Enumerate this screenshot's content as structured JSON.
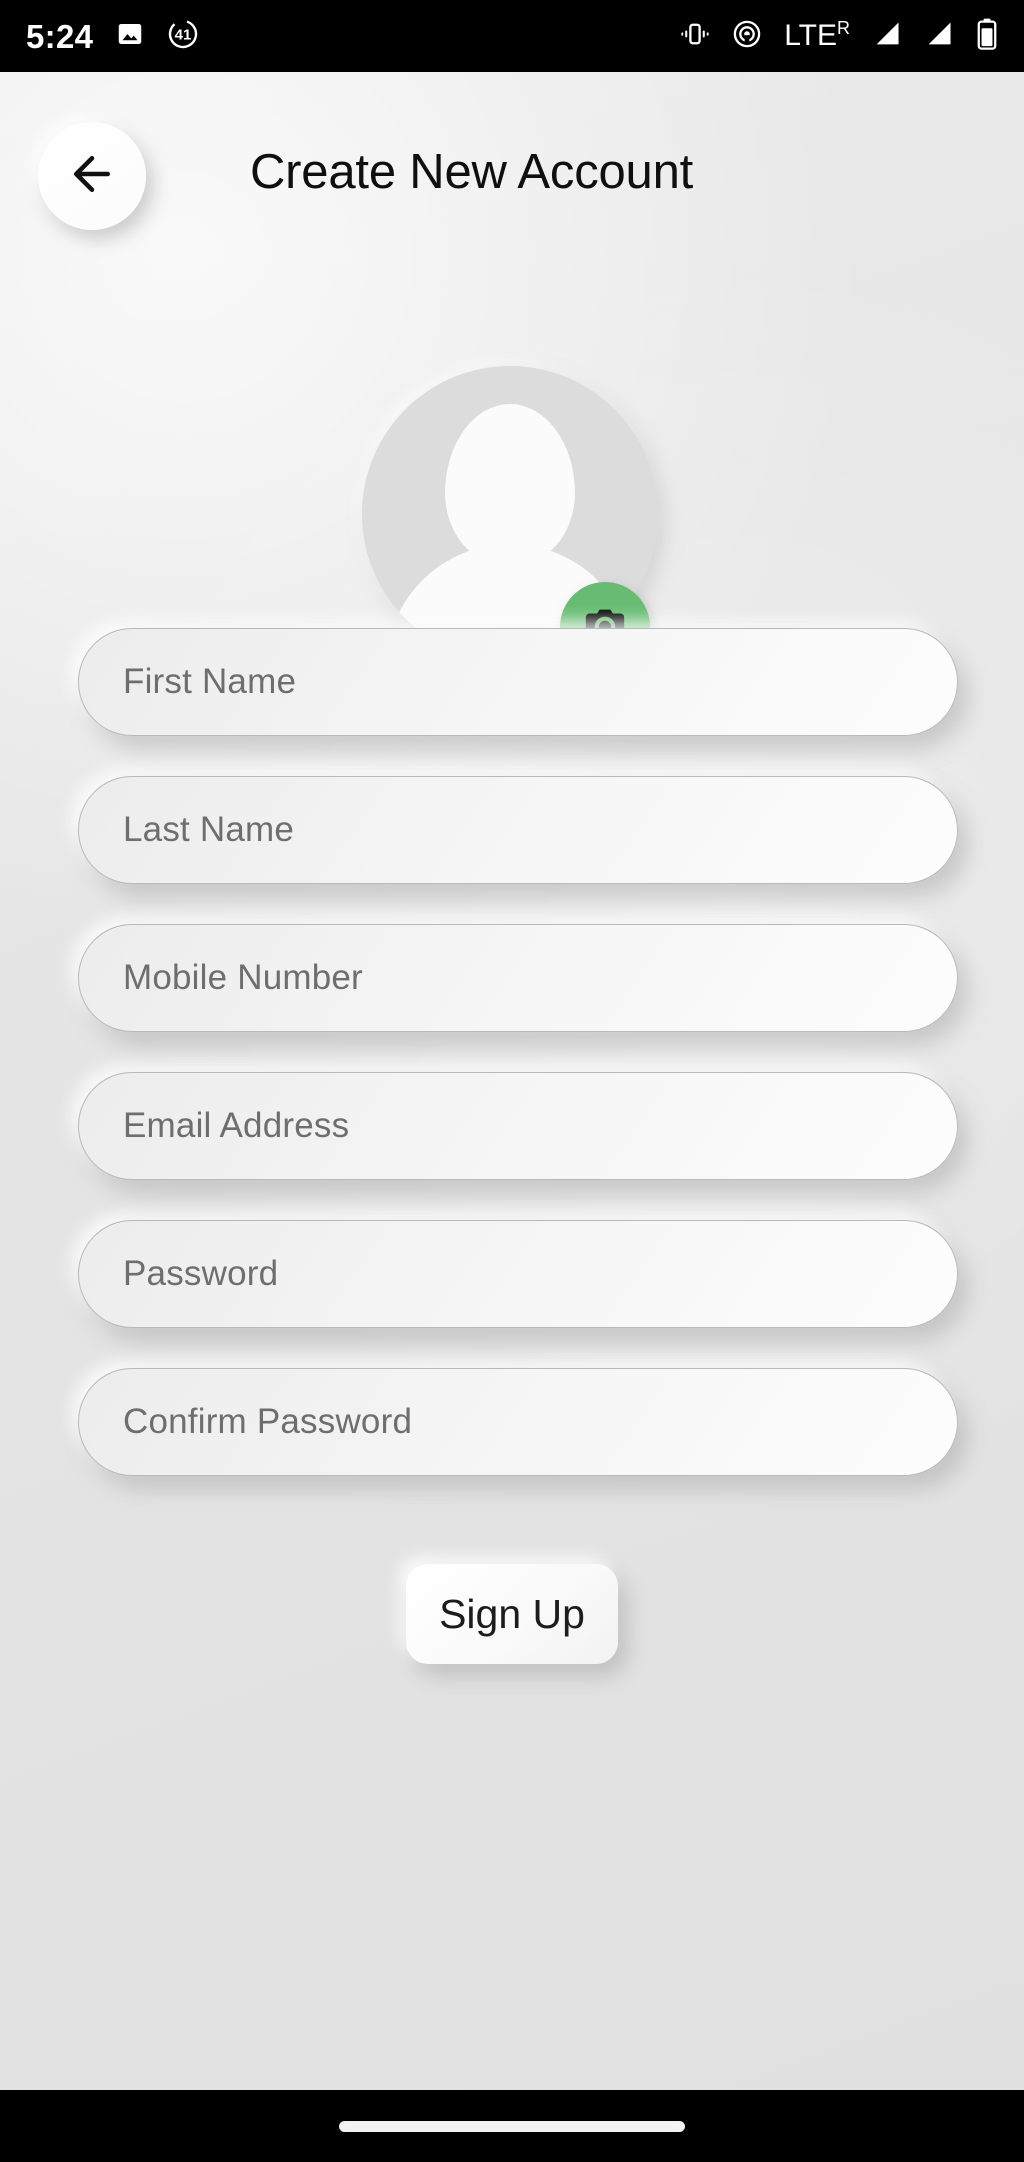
{
  "status_bar": {
    "time": "5:24",
    "left_icons": [
      {
        "name": "image-icon",
        "label": "Photo"
      },
      {
        "name": "timer-badge-icon",
        "label": "41"
      }
    ],
    "badge_value": "41",
    "right_icons": [
      {
        "name": "vibrate-icon",
        "label": "Vibrate"
      },
      {
        "name": "hotspot-icon",
        "label": "Hotspot"
      },
      {
        "name": "lte-icon",
        "label": "LTE"
      },
      {
        "name": "signal-icon-1",
        "label": "Signal 1"
      },
      {
        "name": "signal-icon-2",
        "label": "Signal 2"
      },
      {
        "name": "battery-icon",
        "label": "Battery"
      }
    ],
    "network_label": "LTE",
    "roaming_label": "R"
  },
  "header": {
    "title": "Create New Account",
    "back_icon": "arrow-left-icon"
  },
  "avatar": {
    "placeholder_icon": "person-silhouette-icon",
    "camera_icon": "camera-icon",
    "camera_button_color": "#68bb72"
  },
  "form": {
    "fields": [
      {
        "name": "first-name",
        "placeholder": "First Name",
        "value": "",
        "type": "text"
      },
      {
        "name": "last-name",
        "placeholder": "Last Name",
        "value": "",
        "type": "text"
      },
      {
        "name": "mobile-number",
        "placeholder": "Mobile Number",
        "value": "",
        "type": "tel"
      },
      {
        "name": "email-address",
        "placeholder": "Email Address",
        "value": "",
        "type": "email"
      },
      {
        "name": "password",
        "placeholder": "Password",
        "value": "",
        "type": "password"
      },
      {
        "name": "confirm-password",
        "placeholder": "Confirm Password",
        "value": "",
        "type": "password"
      }
    ]
  },
  "actions": {
    "signup_label": "Sign Up"
  },
  "nav_bar": {
    "gesture_pill": "home-gesture-pill"
  },
  "theme": {
    "background": "#e6e6e6",
    "accent_green": "#68bb72",
    "text_primary": "#0f0f0f",
    "text_placeholder": "#6e6e6e",
    "status_bar_bg": "#000000"
  }
}
